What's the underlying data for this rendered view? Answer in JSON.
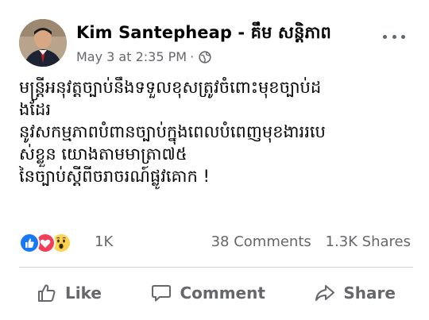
{
  "post": {
    "author": "Kim Santepheap - គឹម សន្តិភាព",
    "timestamp": "May 3 at 2:35 PM",
    "separator": "·",
    "privacy_icon": "globe-icon",
    "more_icon": "more-options-icon",
    "body_lines": [
      "មន្ត្រីអនុវត្តច្បាប់នឹងទទួលខុសត្រូវចំពោះមុខច្បាប់ដ",
      "ងដែរ",
      "នូវសកម្មភាពបំពានច្បាប់ក្នុងពេលបំពេញមុខងាររបេ",
      "ស់ខ្លួន យោងតាមមាត្រា៧៥",
      "នៃច្បាប់ស្តីពីចរាចរណ៍ផ្លូវគោក !"
    ]
  },
  "stats": {
    "reactions": [
      "like",
      "love",
      "wow"
    ],
    "reaction_count": "1K",
    "comments": "38 Comments",
    "shares": "1.3K Shares"
  },
  "actions": {
    "like": "Like",
    "comment": "Comment",
    "share": "Share"
  },
  "colors": {
    "text": "#050505",
    "secondary": "#65676b",
    "like_blue": "#1877f2",
    "love_red": "#f33e58",
    "wow_yellow": "#fcd34d"
  }
}
